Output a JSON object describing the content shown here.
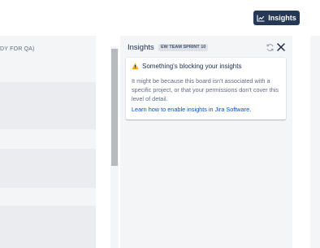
{
  "toolbar": {
    "insights_button_label": "Insights",
    "insights_button_icon": "chart-line-icon",
    "insights_button_color": "#253858"
  },
  "board": {
    "left_column_header": "DY FOR QA)"
  },
  "insights_panel": {
    "title": "Insights",
    "sprint_badge": "EW TEAM SPRINT 10",
    "refresh_icon": "refresh-icon",
    "close_icon": "close-icon",
    "message": {
      "icon": "warning-icon",
      "icon_color": "#ffab00",
      "title": "Something's blocking your insights",
      "body": "It might be because this board isn't associated with a specific project, or that your permissions don't cover this level of detail.",
      "link_text": "Learn how to enable insights in Jira Software.",
      "link_color": "#0052cc"
    }
  }
}
